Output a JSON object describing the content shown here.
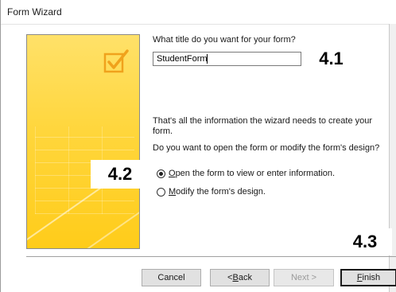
{
  "window": {
    "title": "Form Wizard"
  },
  "question": "What title do you want for your form?",
  "form_title_value": "StudentForm",
  "info": "That's all the information the wizard needs to create your form.",
  "ask": "Do you want to open the form or modify the form's design?",
  "options": [
    {
      "label_u": "O",
      "label_rest": "pen the form to view or enter information.",
      "selected": true
    },
    {
      "label_u": "M",
      "label_rest": "odify the form's design.",
      "selected": false
    }
  ],
  "buttons": {
    "cancel": "Cancel",
    "back_prefix": "< ",
    "back_u": "B",
    "back_rest": "ack",
    "next": "Next >",
    "finish_u": "F",
    "finish_rest": "inish"
  },
  "annotations": {
    "a1": "4.1",
    "a2": "4.2",
    "a3": "4.3"
  },
  "colors": {
    "panel": "#ffd63c",
    "check": "#f0a21c"
  },
  "icon": "checkmark-box-icon"
}
